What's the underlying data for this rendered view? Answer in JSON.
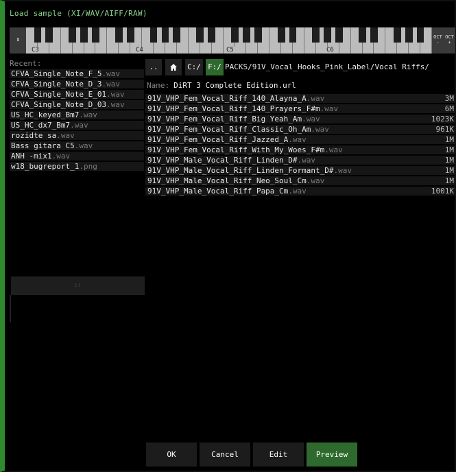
{
  "window": {
    "title": "Load sample (XI/WAV/AIFF/RAW)"
  },
  "keyboard": {
    "octave_labels": [
      "C3",
      "C4",
      "C5",
      "C6"
    ],
    "oct_down_label": "OCT -",
    "oct_up_label": "OCT +",
    "arrow_label": "⬍"
  },
  "recent": {
    "label": "Recent:",
    "items": [
      {
        "name": "CFVA_Single_Note_F_5",
        "ext": ".wav"
      },
      {
        "name": "CFVA_Single_Note_D_3",
        "ext": ".wav"
      },
      {
        "name": "CFVA_Single_Note_E_01",
        "ext": ".wav"
      },
      {
        "name": "CFVA_Single_Note_D_03",
        "ext": ".wav"
      },
      {
        "name": "US_HC_keyed_Bm7",
        "ext": ".wav"
      },
      {
        "name": "US_HC_dx7_Bm7",
        "ext": ".wav"
      },
      {
        "name": "rozidte sa",
        "ext": ".wav"
      },
      {
        "name": "Bass gitara C5",
        "ext": ".wav"
      },
      {
        "name": "ANH -mix1",
        "ext": ".wav"
      },
      {
        "name": "w18_bugreport_1",
        "ext": ".png"
      }
    ],
    "splitter": "::"
  },
  "path": {
    "up_label": "..",
    "home_icon": "home-icon",
    "drive_c": "C:/",
    "drive_f": "F:/",
    "current": "PACKS/91V_Vocal_Hooks_Pink_Label/Vocal Riffs/"
  },
  "name_field": {
    "label": "Name:",
    "value": "DiRT 3 Complete Edition.url"
  },
  "files": [
    {
      "name": "91V_VHP_Fem_Vocal_Riff_140_Alayna_A",
      "ext": ".wav",
      "size": "3M"
    },
    {
      "name": "91V_VHP_Fem_Vocal_Riff_140_Prayers_F#m",
      "ext": ".wav",
      "size": "6M"
    },
    {
      "name": "91V_VHP_Fem_Vocal_Riff_Big Yeah_Am",
      "ext": ".wav",
      "size": "1023K"
    },
    {
      "name": "91V_VHP_Fem_Vocal_Riff_Classic_Oh_Am",
      "ext": ".wav",
      "size": "961K"
    },
    {
      "name": "91V_VHP_Fem_Vocal_Riff_Jazzed_A",
      "ext": ".wav",
      "size": "1M"
    },
    {
      "name": "91V_VHP_Fem_Vocal_Riff_With_My_Woes_F#m",
      "ext": ".wav",
      "size": "1M"
    },
    {
      "name": "91V_VHP_Male_Vocal_Riff_Linden_D#",
      "ext": ".wav",
      "size": "1M"
    },
    {
      "name": "91V_VHP_Male_Vocal_Riff_Linden_Formant_D#",
      "ext": ".wav",
      "size": "1M"
    },
    {
      "name": "91V_VHP_Male_Vocal_Riff_Neo_Soul_Cm",
      "ext": ".wav",
      "size": "1M"
    },
    {
      "name": "91V_VHP_Male_Vocal_Riff_Papa_Cm",
      "ext": ".wav",
      "size": "1001K"
    }
  ],
  "buttons": {
    "ok": "OK",
    "cancel": "Cancel",
    "edit": "Edit",
    "preview": "Preview"
  },
  "colors": {
    "accent": "#2e6a2e",
    "border": "#2e8a2e",
    "title_text": "#8fd88f"
  }
}
